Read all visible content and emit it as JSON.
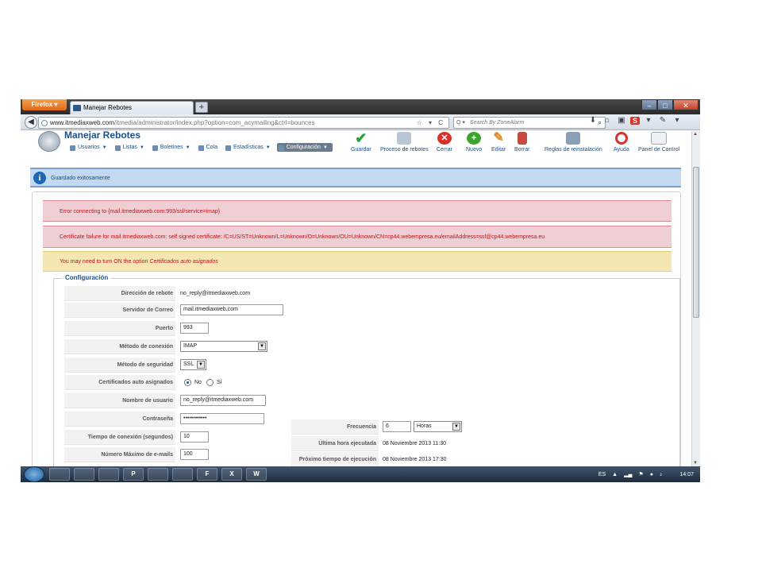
{
  "browser": {
    "firefox_label": "Firefox",
    "tab_title": "Manejar Rebotes",
    "url_domain": "www.itmediaxweb.com",
    "url_path": "/itmedia/administrator/index.php?option=com_acymailing&ctrl=bounces",
    "search_placeholder": "Search By ZoneAlarm"
  },
  "page": {
    "title": "Manejar Rebotes",
    "menu": [
      {
        "label": "Usuarios",
        "icon": "users-icon"
      },
      {
        "label": "Listas",
        "icon": "lists-icon"
      },
      {
        "label": "Boletines",
        "icon": "newsletter-icon"
      },
      {
        "label": "Cola",
        "icon": "queue-icon"
      },
      {
        "label": "Estadísticas",
        "icon": "stats-icon"
      },
      {
        "label": "Configuración",
        "icon": "config-icon"
      }
    ],
    "toolbar": {
      "save": "Guardar",
      "process": "Proceso de rebotes",
      "close": "Cerrar",
      "new": "Nuevo",
      "edit": "Editar",
      "delete": "Borrar",
      "rules": "Reglas de reinstalación",
      "help": "Ayuda",
      "panel": "Panel de Control"
    },
    "messages": {
      "saved": "Guardado exitosamente",
      "error1": "Error connecting to {mail.itmediaxweb.com:993/ssl/service=imap}",
      "error2": "Certificate failure for mail.itmediaxweb.com: self signed certificate: /C=US/ST=Unknown/L=Unknown/O=Unknown/OU=Unknown/CN=cp44.webempresa.eu/emailAddress=ssl@cp44.webempresa.eu",
      "warn_prefix": "You may need to turn ON the option",
      "warn_option": "Certificados auto asignados"
    },
    "config": {
      "legend": "Configuración",
      "bounce_address_label": "Dirección de rebote",
      "bounce_address": "no_reply@itmediaxweb.com",
      "mail_server_label": "Servidor de Correo",
      "mail_server": "mail.itmediaxweb.com",
      "port_label": "Puerto",
      "port": "993",
      "connection_method_label": "Método de conexión",
      "connection_method": "IMAP",
      "security_method_label": "Método de seguridad",
      "security_method": "SSL",
      "self_signed_label": "Certificados auto asignados",
      "self_signed_no": "No",
      "self_signed_yes": "Sí",
      "username_label": "Nombre de usuario",
      "username": "no_reply@itmediaxweb.com",
      "password_label": "Contraseña",
      "password": "••••••••••••",
      "timeout_label": "Tiempo de conexión (segundos)",
      "timeout": "10",
      "max_emails_label": "Número Máximo de e-mails",
      "max_emails": "100",
      "frequency_label": "Frecuencia",
      "frequency_value": "6",
      "frequency_unit": "Horas",
      "last_run_label": "Última hora ejecutada",
      "last_run": "08 Noviembre 2013 11:30",
      "next_run_label": "Próximo tiempo de ejecución",
      "next_run": "08 Noviembre 2013 17:30"
    }
  },
  "taskbar": {
    "apps": [
      "",
      "",
      "",
      "P",
      "",
      "",
      "F",
      "X",
      "W"
    ],
    "lang": "ES",
    "clock": "14:07"
  }
}
